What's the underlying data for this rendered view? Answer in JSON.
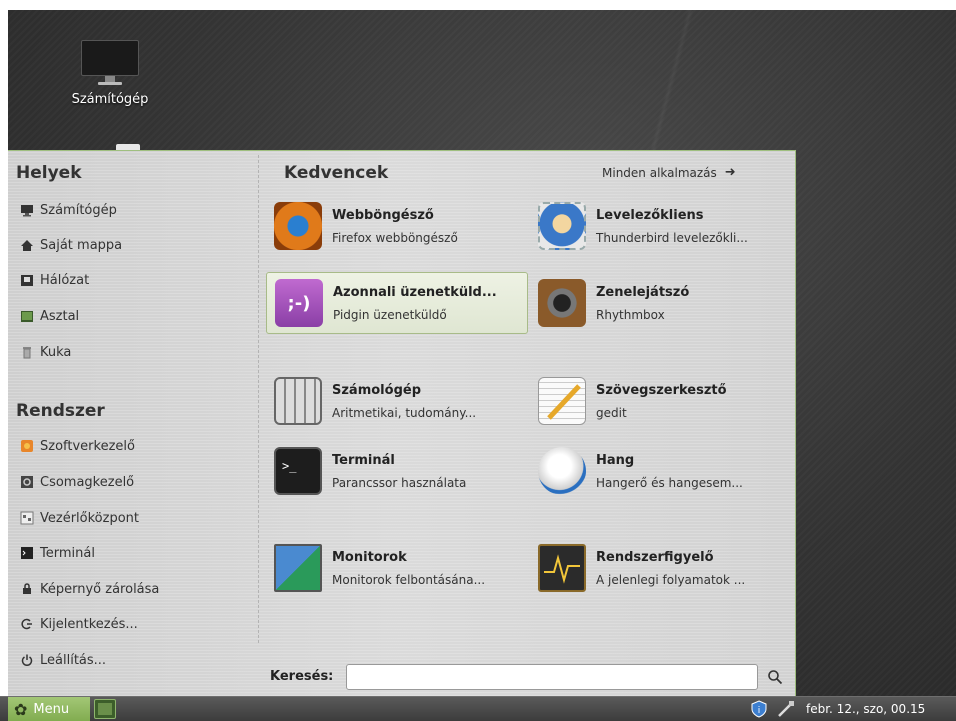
{
  "desktop": {
    "icon_label": "Számítógép"
  },
  "places": {
    "title": "Helyek",
    "items": [
      {
        "label": "Számítógép",
        "icon": "computer-icon"
      },
      {
        "label": "Saját mappa",
        "icon": "home-icon"
      },
      {
        "label": "Hálózat",
        "icon": "network-icon"
      },
      {
        "label": "Asztal",
        "icon": "desktop-icon"
      },
      {
        "label": "Kuka",
        "icon": "trash-icon"
      }
    ]
  },
  "system": {
    "title": "Rendszer",
    "items": [
      {
        "label": "Szoftverkezelő",
        "icon": "software-manager-icon"
      },
      {
        "label": "Csomagkezelő",
        "icon": "package-manager-icon"
      },
      {
        "label": "Vezérlőközpont",
        "icon": "control-center-icon"
      },
      {
        "label": "Terminál",
        "icon": "terminal-icon"
      },
      {
        "label": "Képernyő zárolása",
        "icon": "lock-icon"
      },
      {
        "label": "Kijelentkezés...",
        "icon": "logout-icon"
      },
      {
        "label": "Leállítás...",
        "icon": "power-icon"
      }
    ]
  },
  "favorites": {
    "title": "Kedvencek",
    "all_apps": "Minden alkalmazás",
    "apps": [
      {
        "name": "Webböngésző",
        "desc": "Firefox webböngésző",
        "icon": "firefox-icon"
      },
      {
        "name": "Levelezőkliens",
        "desc": "Thunderbird levelezőkli...",
        "icon": "thunderbird-icon"
      },
      {
        "name": "Azonnali üzenetküld...",
        "desc": "Pidgin üzenetküldő",
        "icon": "pidgin-icon"
      },
      {
        "name": "Zenelejátszó",
        "desc": "Rhythmbox",
        "icon": "speaker-icon"
      },
      {
        "name": "Számológép",
        "desc": "Aritmetikai, tudomány...",
        "icon": "calculator-icon"
      },
      {
        "name": "Szövegszerkesztő",
        "desc": "gedit",
        "icon": "text-editor-icon"
      },
      {
        "name": "Terminál",
        "desc": "Parancssor használata",
        "icon": "terminal-app-icon"
      },
      {
        "name": "Hang",
        "desc": "Hangerő és hangesem...",
        "icon": "volume-knob-icon"
      },
      {
        "name": "Monitorok",
        "desc": "Monitorok felbontásána...",
        "icon": "monitors-icon"
      },
      {
        "name": "Rendszerfigyelő",
        "desc": "A jelenlegi folyamatok ...",
        "icon": "system-monitor-icon"
      }
    ]
  },
  "search": {
    "label": "Keresés:",
    "value": ""
  },
  "panel": {
    "menu_label": "Menu",
    "clock": "febr. 12., szo, 00.15"
  },
  "colors": {
    "accent": "#8fb85e",
    "selected_bg": "#e6ecda"
  }
}
